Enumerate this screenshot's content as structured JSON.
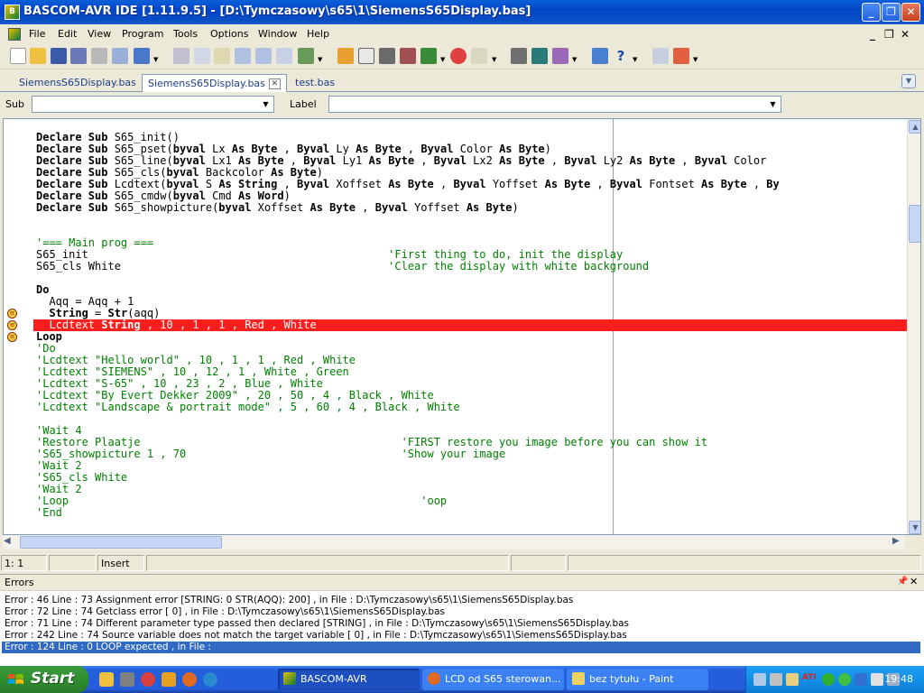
{
  "window": {
    "title": "BASCOM-AVR IDE [1.11.9.5] - [D:\\Tymczasowy\\s65\\1\\SiemensS65Display.bas]",
    "app_icon": "bascom-icon"
  },
  "menu": {
    "items": [
      "File",
      "Edit",
      "View",
      "Program",
      "Tools",
      "Options",
      "Window",
      "Help"
    ],
    "mdi_controls": [
      "_",
      "❐",
      "✕"
    ]
  },
  "tabs": [
    {
      "label": "SiemensS65Display.bas",
      "active": false
    },
    {
      "label": "SiemensS65Display.bas",
      "active": true
    },
    {
      "label": "test.bas",
      "active": false
    }
  ],
  "selectors": {
    "sub_label": "Sub",
    "sub_value": "",
    "label_label": "Label",
    "label_value": ""
  },
  "code_lines": [
    {
      "segs": [
        {
          "t": "Declare Sub ",
          "c": "kw"
        },
        {
          "t": "S65_init()"
        }
      ]
    },
    {
      "segs": [
        {
          "t": "Declare Sub ",
          "c": "kw"
        },
        {
          "t": "S65_pset("
        },
        {
          "t": "byval ",
          "c": "kw"
        },
        {
          "t": "Lx "
        },
        {
          "t": "As Byte",
          "c": "kw"
        },
        {
          "t": " , "
        },
        {
          "t": "Byval ",
          "c": "kw"
        },
        {
          "t": "Ly "
        },
        {
          "t": "As Byte",
          "c": "kw"
        },
        {
          "t": " , "
        },
        {
          "t": "Byval ",
          "c": "kw"
        },
        {
          "t": "Color "
        },
        {
          "t": "As Byte",
          "c": "kw"
        },
        {
          "t": ")"
        }
      ]
    },
    {
      "segs": [
        {
          "t": "Declare Sub ",
          "c": "kw"
        },
        {
          "t": "S65_line("
        },
        {
          "t": "byval ",
          "c": "kw"
        },
        {
          "t": "Lx1 "
        },
        {
          "t": "As Byte",
          "c": "kw"
        },
        {
          "t": " , "
        },
        {
          "t": "Byval ",
          "c": "kw"
        },
        {
          "t": "Ly1 "
        },
        {
          "t": "As Byte",
          "c": "kw"
        },
        {
          "t": " , "
        },
        {
          "t": "Byval ",
          "c": "kw"
        },
        {
          "t": "Lx2 "
        },
        {
          "t": "As Byte",
          "c": "kw"
        },
        {
          "t": " , "
        },
        {
          "t": "Byval ",
          "c": "kw"
        },
        {
          "t": "Ly2 "
        },
        {
          "t": "As Byte",
          "c": "kw"
        },
        {
          "t": " , "
        },
        {
          "t": "Byval ",
          "c": "kw"
        },
        {
          "t": "Color "
        }
      ]
    },
    {
      "segs": [
        {
          "t": "Declare Sub ",
          "c": "kw"
        },
        {
          "t": "S65_cls("
        },
        {
          "t": "byval ",
          "c": "kw"
        },
        {
          "t": "Backcolor "
        },
        {
          "t": "As Byte",
          "c": "kw"
        },
        {
          "t": ")"
        }
      ]
    },
    {
      "segs": [
        {
          "t": "Declare Sub ",
          "c": "kw"
        },
        {
          "t": "Lcdtext("
        },
        {
          "t": "byval ",
          "c": "kw"
        },
        {
          "t": "S "
        },
        {
          "t": "As String",
          "c": "kw"
        },
        {
          "t": " , "
        },
        {
          "t": "Byval ",
          "c": "kw"
        },
        {
          "t": "Xoffset "
        },
        {
          "t": "As Byte",
          "c": "kw"
        },
        {
          "t": " , "
        },
        {
          "t": "Byval ",
          "c": "kw"
        },
        {
          "t": "Yoffset "
        },
        {
          "t": "As Byte",
          "c": "kw"
        },
        {
          "t": " , "
        },
        {
          "t": "Byval ",
          "c": "kw"
        },
        {
          "t": "Fontset "
        },
        {
          "t": "As Byte",
          "c": "kw"
        },
        {
          "t": " , "
        },
        {
          "t": "By",
          "c": "kw"
        }
      ]
    },
    {
      "segs": [
        {
          "t": "Declare Sub ",
          "c": "kw"
        },
        {
          "t": "S65_cmdw("
        },
        {
          "t": "byval ",
          "c": "kw"
        },
        {
          "t": "Cmd "
        },
        {
          "t": "As Word",
          "c": "kw"
        },
        {
          "t": ")"
        }
      ]
    },
    {
      "segs": [
        {
          "t": "Declare Sub ",
          "c": "kw"
        },
        {
          "t": "S65_showpicture("
        },
        {
          "t": "byval ",
          "c": "kw"
        },
        {
          "t": "Xoffset "
        },
        {
          "t": "As Byte",
          "c": "kw"
        },
        {
          "t": " , "
        },
        {
          "t": "Byval ",
          "c": "kw"
        },
        {
          "t": "Yoffset "
        },
        {
          "t": "As Byte",
          "c": "kw"
        },
        {
          "t": ")"
        }
      ]
    },
    {
      "segs": []
    },
    {
      "segs": []
    },
    {
      "segs": [
        {
          "t": "'=== Main prog ===",
          "c": "cm"
        }
      ]
    },
    {
      "segs": [
        {
          "t": "S65_init                                              "
        },
        {
          "t": "'First thing to do, init the display",
          "c": "cm"
        }
      ]
    },
    {
      "segs": [
        {
          "t": "S65_cls White                                         "
        },
        {
          "t": "'Clear the display with white background",
          "c": "cm"
        }
      ]
    },
    {
      "segs": []
    },
    {
      "segs": [
        {
          "t": "Do",
          "c": "kw"
        }
      ]
    },
    {
      "segs": [
        {
          "t": "  Aqq = Aqq + 1"
        }
      ]
    },
    {
      "segs": [
        {
          "t": "  "
        },
        {
          "t": "String",
          "c": "kw"
        },
        {
          "t": " = "
        },
        {
          "t": "Str",
          "c": "kw"
        },
        {
          "t": "(aqq)"
        }
      ]
    },
    {
      "segs": [
        {
          "t": "  Lcdtext "
        },
        {
          "t": "String",
          "c": "kw"
        },
        {
          "t": " , 10 , 1 , 1 , Red , White"
        }
      ],
      "highlight": true
    },
    {
      "segs": [
        {
          "t": "Loop",
          "c": "kw"
        }
      ]
    },
    {
      "segs": [
        {
          "t": "'Do",
          "c": "cm"
        }
      ]
    },
    {
      "segs": [
        {
          "t": "'Lcdtext \"Hello world\" , 10 , 1 , 1 , Red , White",
          "c": "cm"
        }
      ]
    },
    {
      "segs": [
        {
          "t": "'Lcdtext \"SIEMENS\" , 10 , 12 , 1 , White , Green",
          "c": "cm"
        }
      ]
    },
    {
      "segs": [
        {
          "t": "'Lcdtext \"S-65\" , 10 , 23 , 2 , Blue , White",
          "c": "cm"
        }
      ]
    },
    {
      "segs": [
        {
          "t": "'Lcdtext \"By Evert Dekker 2009\" , 20 , 50 , 4 , Black , White",
          "c": "cm"
        }
      ]
    },
    {
      "segs": [
        {
          "t": "'Lcdtext \"Landscape & portrait mode\" , 5 , 60 , 4 , Black , White",
          "c": "cm"
        }
      ]
    },
    {
      "segs": []
    },
    {
      "segs": [
        {
          "t": "'Wait 4",
          "c": "cm"
        }
      ]
    },
    {
      "segs": [
        {
          "t": "'Restore Plaatje                                        'FIRST restore you image before you can show it",
          "c": "cm"
        }
      ]
    },
    {
      "segs": [
        {
          "t": "'S65_showpicture 1 , 70                                 'Show your image",
          "c": "cm"
        }
      ]
    },
    {
      "segs": [
        {
          "t": "'Wait 2",
          "c": "cm"
        }
      ]
    },
    {
      "segs": [
        {
          "t": "'S65_cls White",
          "c": "cm"
        }
      ]
    },
    {
      "segs": [
        {
          "t": "'Wait 2",
          "c": "cm"
        }
      ]
    },
    {
      "segs": [
        {
          "t": "'Loop                                                      'oop",
          "c": "cm"
        }
      ]
    },
    {
      "segs": [
        {
          "t": "'End",
          "c": "cm"
        }
      ]
    }
  ],
  "gutter_marks": {
    "line_indices": [
      15,
      16,
      17
    ],
    "icon": "breakpoint-icon"
  },
  "statusbar": {
    "position": "1: 1",
    "field2": "",
    "mode": "Insert",
    "field4": "",
    "field5": "",
    "field6": ""
  },
  "errors_panel": {
    "title": "Errors",
    "pin_icon": "pin-icon",
    "close_icon": "close-icon",
    "rows": [
      {
        "text": "Error : 46    Line :   73    Assignment error [STRING: 0   STR(AQQ): 200]  , in File : D:\\Tymczasowy\\s65\\1\\SiemensS65Display.bas",
        "selected": false
      },
      {
        "text": "Error : 72    Line :   74    Getclass error [ 0]  , in File : D:\\Tymczasowy\\s65\\1\\SiemensS65Display.bas",
        "selected": false
      },
      {
        "text": "Error : 71    Line :   74    Different parameter type passed then declared [STRING]  , in File : D:\\Tymczasowy\\s65\\1\\SiemensS65Display.bas",
        "selected": false
      },
      {
        "text": "Error : 242   Line :   74    Source variable does not match the target variable [ 0]  , in File : D:\\Tymczasowy\\s65\\1\\SiemensS65Display.bas",
        "selected": false
      },
      {
        "text": "Error : 124   Line :    0    LOOP expected  , in File :",
        "selected": true
      }
    ]
  },
  "taskbar": {
    "start_label": "Start",
    "quicklaunch": [
      "clock-icon",
      "disk-icon",
      "media-icon",
      "winamp-icon",
      "firefox-icon",
      "globe-icon"
    ],
    "tasks": [
      {
        "label": "BASCOM-AVR",
        "icon": "bascom-icon",
        "active": true
      },
      {
        "label": "LCD od S65 sterowan...",
        "icon": "firefox-icon",
        "active": false
      },
      {
        "label": "bez tytułu - Paint",
        "icon": "paint-icon",
        "active": false
      }
    ],
    "tray_icons": [
      "network-icon",
      "monitor-icon",
      "volume-icon",
      "ati-icon",
      "shield-icon",
      "update-icon",
      "sync-icon",
      "speaker-icon",
      "lan-icon"
    ],
    "tray_ati_label": "ATI",
    "clock": "19:48"
  },
  "colors": {
    "highlight_line": "#ff1e1e",
    "comment": "#008000",
    "selection": "#316ac5",
    "titlebar": "#0a4ec4"
  }
}
